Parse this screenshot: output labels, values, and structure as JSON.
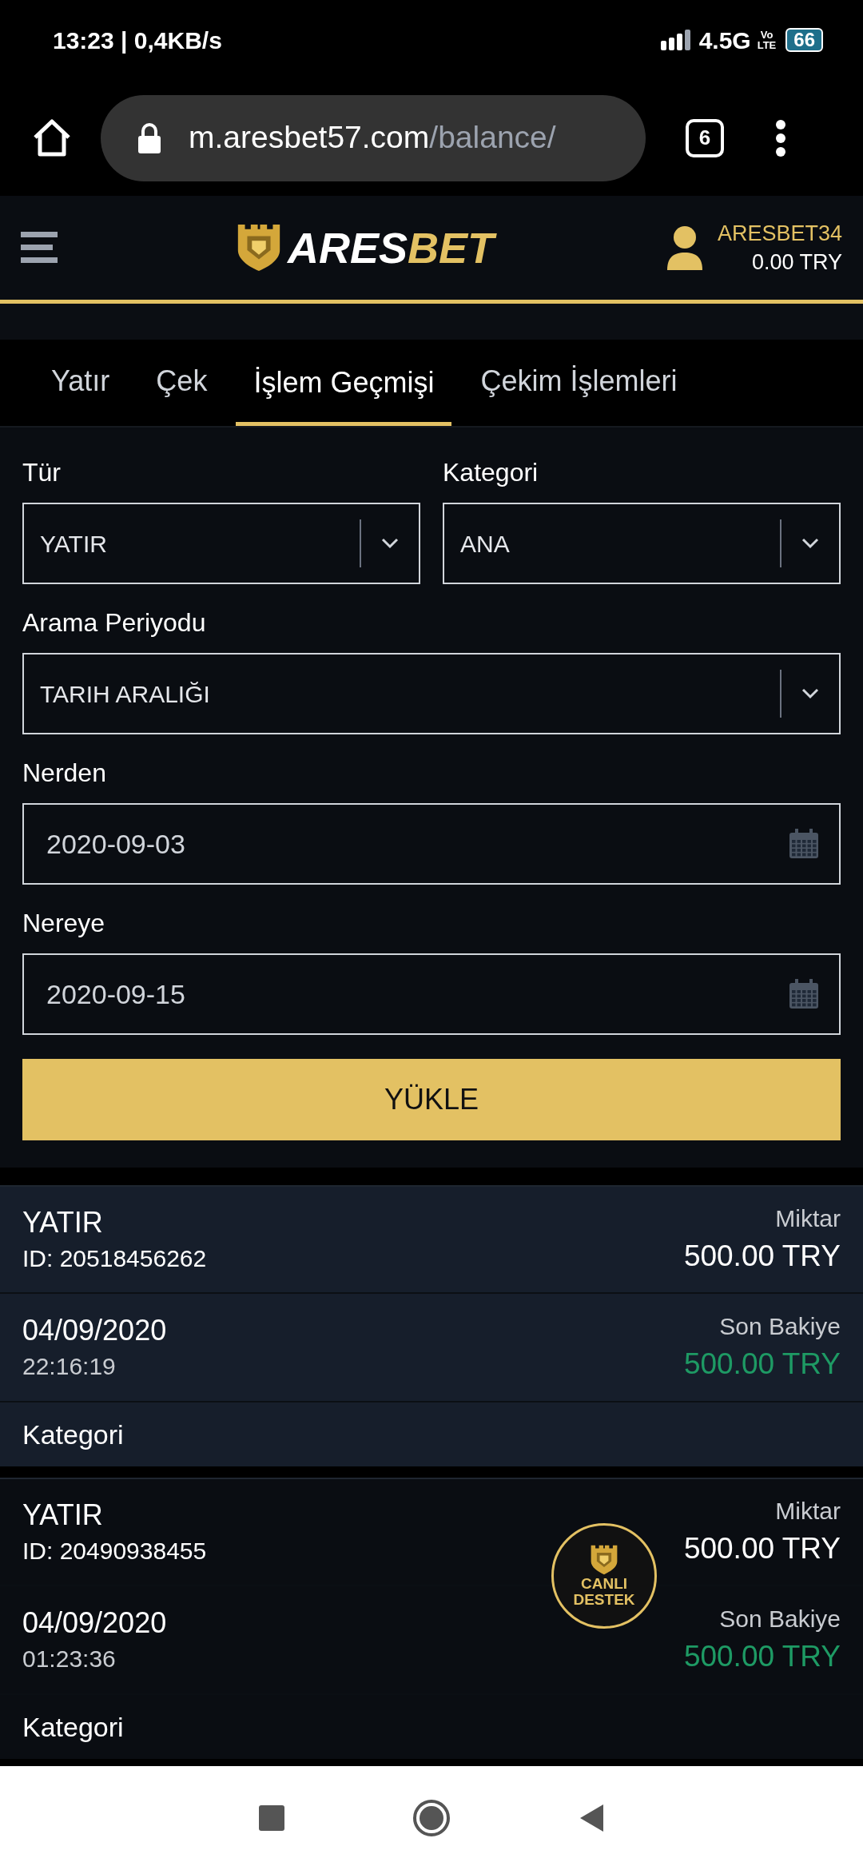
{
  "status_bar": {
    "time": "13:23 | 0,4KB/s",
    "network": "4.5G",
    "volte_top": "Vo",
    "volte_bottom": "LTE",
    "battery": "66"
  },
  "browser": {
    "url_host": "m.aresbet57.com",
    "url_path": "/balance/",
    "tab_count": "6"
  },
  "header": {
    "logo_left": "ARES",
    "logo_right": "BET",
    "username": "ARESBET34",
    "balance": "0.00 TRY"
  },
  "tabs": [
    {
      "label": "Yatır",
      "selected": false
    },
    {
      "label": "Çek",
      "selected": false
    },
    {
      "label": "İşlem Geçmişi",
      "selected": true
    },
    {
      "label": "Çekim İşlemleri",
      "selected": false
    }
  ],
  "filter_rows": [
    [
      {
        "kind": "select",
        "label": "Tür",
        "value": "YATIR"
      },
      {
        "kind": "select",
        "label": "Kategori",
        "value": "ANA"
      }
    ],
    [
      {
        "kind": "select",
        "label": "Arama Periyodu",
        "value": "TARIH ARALIĞI"
      }
    ],
    [
      {
        "kind": "date",
        "label": "Nerden",
        "value": "2020-09-03"
      }
    ],
    [
      {
        "kind": "date",
        "label": "Nereye",
        "value": "2020-09-15"
      }
    ]
  ],
  "load_button": "YÜKLE",
  "transactions": [
    {
      "selected": true,
      "type": "YATIR",
      "id": "ID: 20518456262",
      "amount_label": "Miktar",
      "amount": "500.00 TRY",
      "date": "04/09/2020",
      "time": "22:16:19",
      "balance_label": "Son Bakiye",
      "balance": "500.00 TRY",
      "category_label": "Kategori"
    },
    {
      "selected": false,
      "type": "YATIR",
      "id": "ID: 20490938455",
      "amount_label": "Miktar",
      "amount": "500.00 TRY",
      "date": "04/09/2020",
      "time": "01:23:36",
      "balance_label": "Son Bakiye",
      "balance": "500.00 TRY",
      "category_label": "Kategori"
    }
  ],
  "support": {
    "line1": "CANLI",
    "line2": "DESTEK"
  }
}
